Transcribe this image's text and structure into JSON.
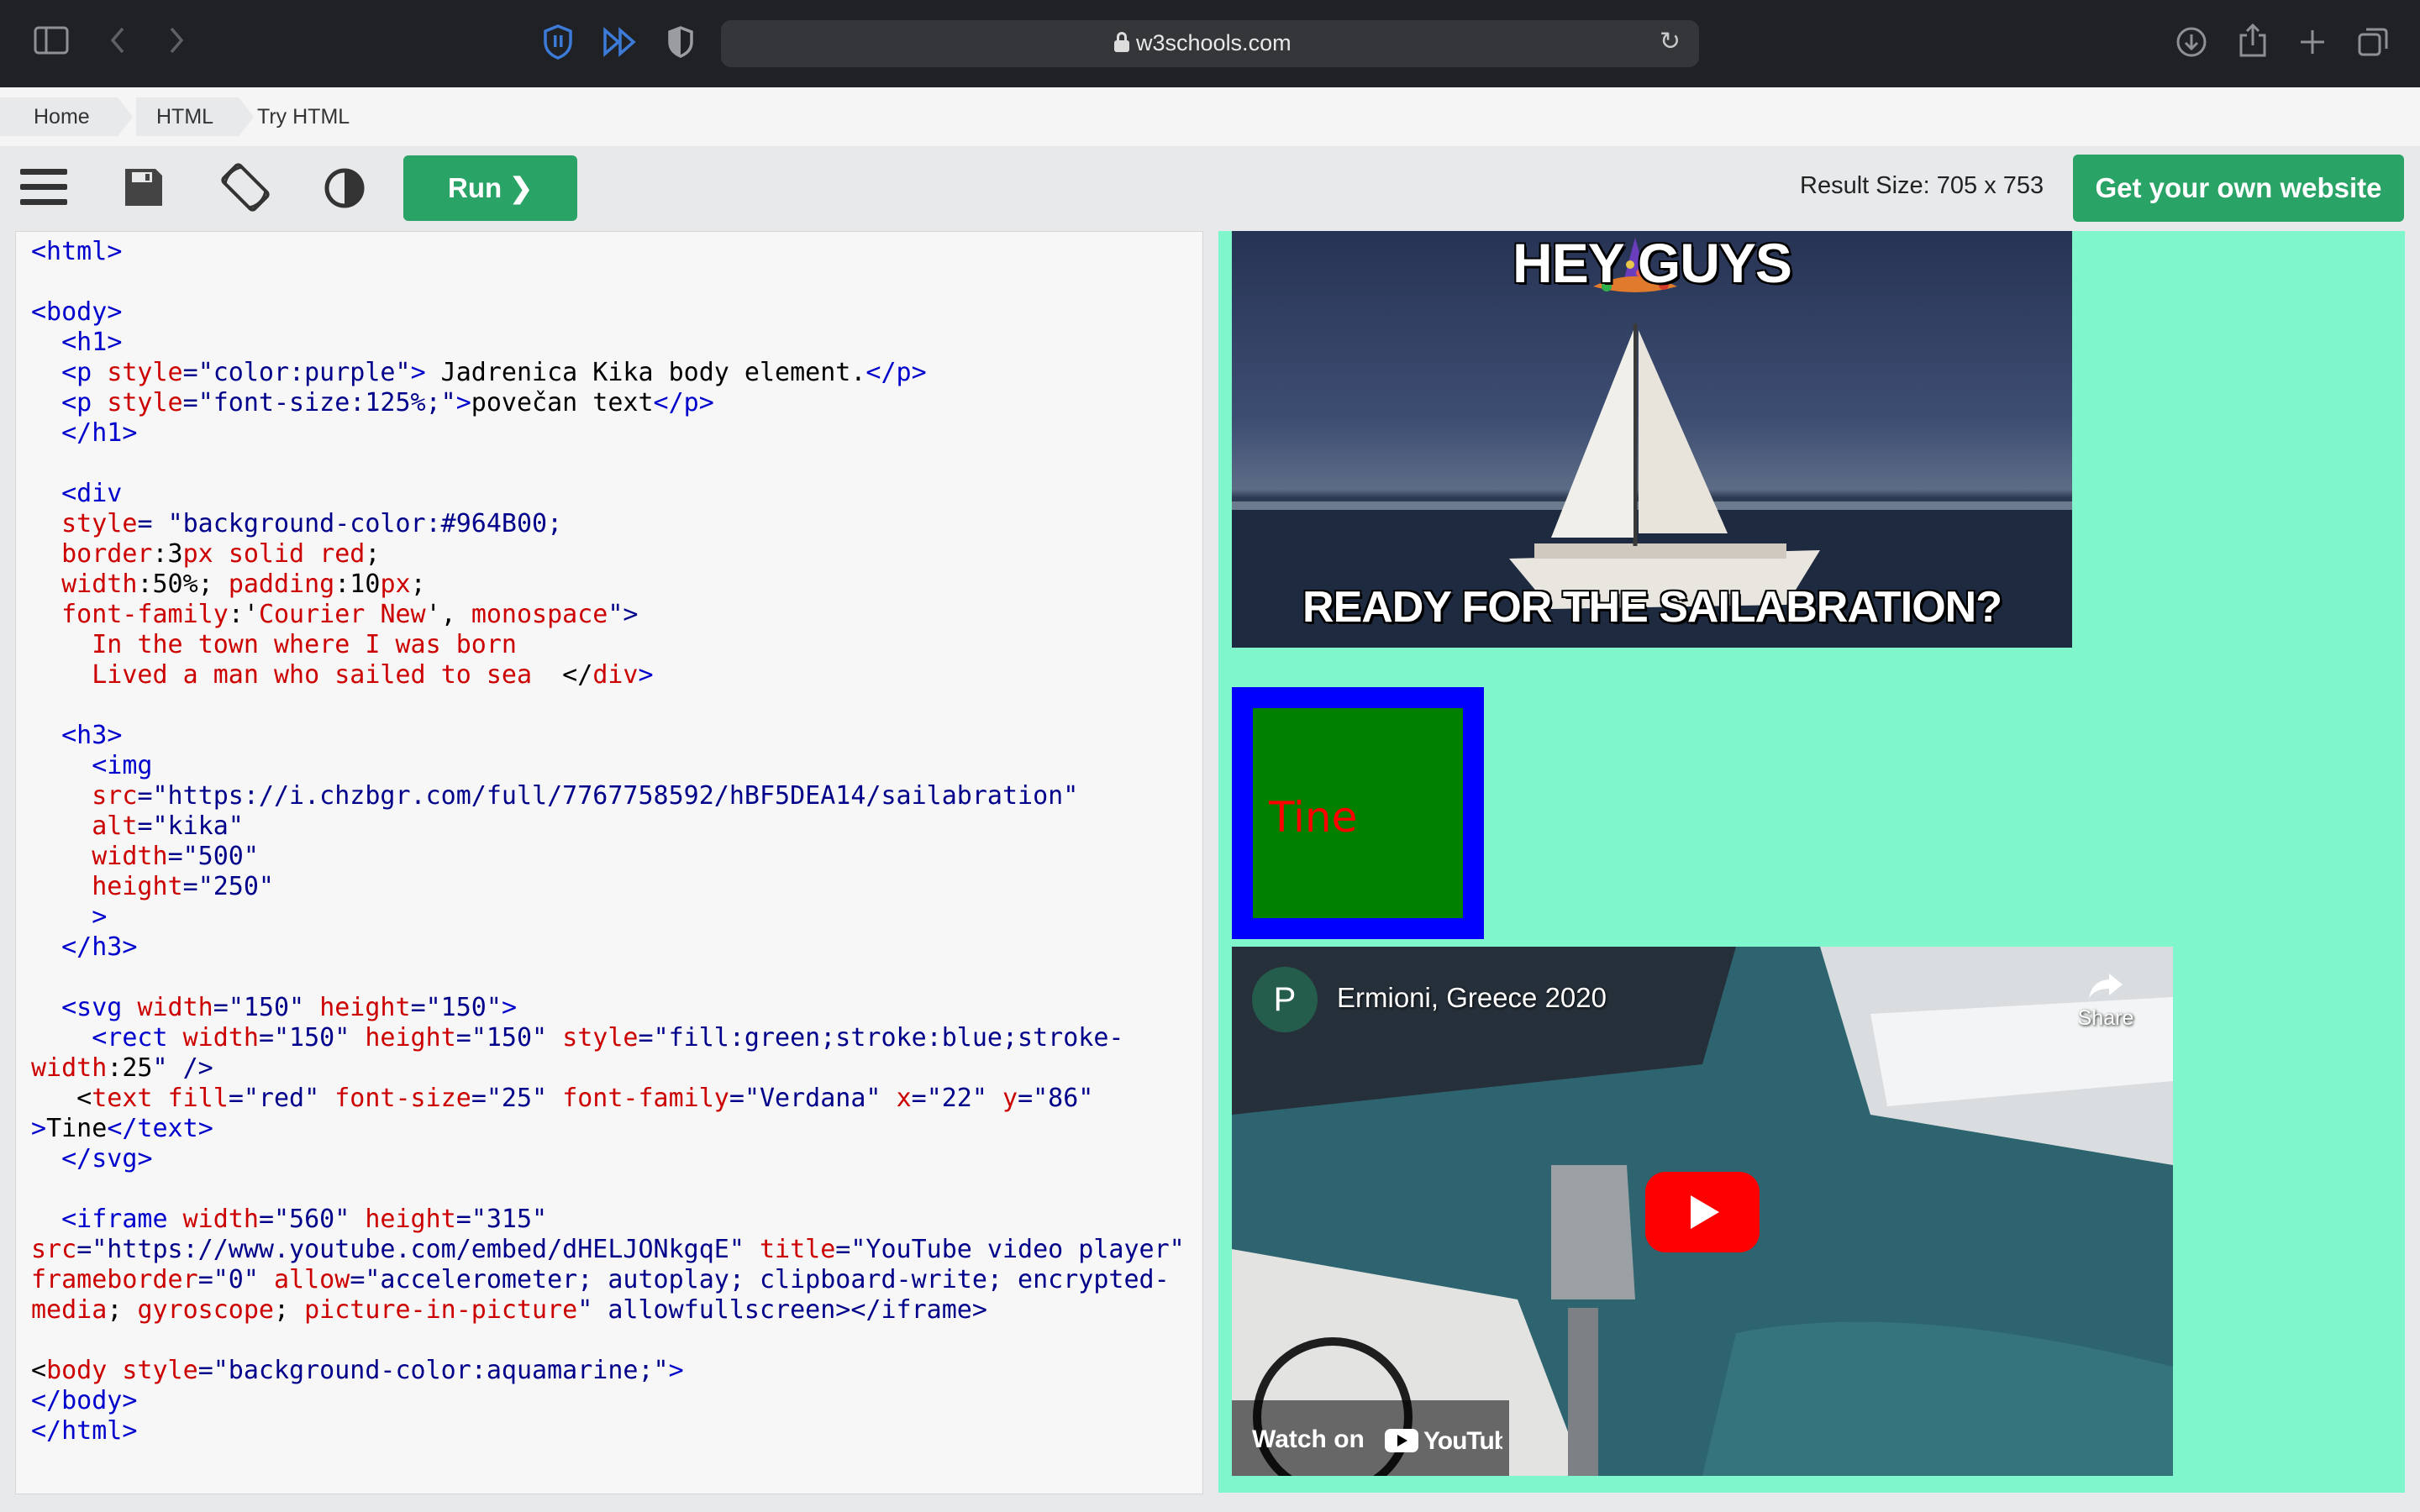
{
  "browser": {
    "url": "w3schools.com"
  },
  "breadcrumb": {
    "items": [
      "Home",
      "HTML",
      "Try HTML"
    ]
  },
  "toolbar": {
    "run_label": "Run ❯",
    "result_size": "Result Size: 705 x 753",
    "get_website_label": "Get your own website"
  },
  "editor": {
    "lines": [
      "<html>",
      "",
      "<body>",
      "  <h1>",
      "  <p style=\"color:purple\"> Jadrenica Kika body element.</p>",
      "  <p style=\"font-size:125%;\">povečan text</p>",
      "  </h1>",
      "",
      "  <div",
      "  style= \"background-color:#964B00;",
      "  border:3px solid red;",
      "  width:50%; padding:10px;",
      "  font-family:'Courier New', monospace\">",
      "    In the town where I was born",
      "    Lived a man who sailed to sea  </div>",
      "",
      "  <h3>",
      "    <img",
      "    src=\"https://i.chzbgr.com/full/7767758592/hBF5DEA14/sailabration\"",
      "    alt=\"kika\"",
      "    width=\"500\"",
      "    height=\"250\"",
      "    >",
      "  </h3>",
      "",
      "  <svg width=\"150\" height=\"150\">",
      "    <rect width=\"150\" height=\"150\" style=\"fill:green;stroke:blue;stroke-",
      "width:25\" />",
      "   <text fill=\"red\" font-size=\"25\" font-family=\"Verdana\" x=\"22\" y=\"86\"",
      ">Tine</text>",
      "  </svg>",
      "",
      "  <iframe width=\"560\" height=\"315\"",
      "src=\"https://www.youtube.com/embed/dHELJONkgqE\" title=\"YouTube video player\"",
      "frameborder=\"0\" allow=\"accelerometer; autoplay; clipboard-write; encrypted-",
      "media; gyroscope; picture-in-picture\" allowfullscreen></iframe>",
      "",
      "<body style=\"background-color:aquamarine;\">",
      "</body>",
      "</html>"
    ]
  },
  "result": {
    "meme_top": "HEY GUYS",
    "meme_bottom": "READY FOR THE SAILABRATION?",
    "svg_text": "Tine",
    "video": {
      "avatar_letter": "P",
      "title": "Ermioni, Greece 2020",
      "share_label": "Share",
      "watch_on": "Watch on",
      "youtube_logo": "YouTube"
    }
  },
  "colors": {
    "result_bg": "#7ff6cc",
    "run_green": "#2aa366",
    "tag_blue": "#0000cd",
    "attr_red": "#cc0000",
    "value_navy": "#00008b"
  }
}
